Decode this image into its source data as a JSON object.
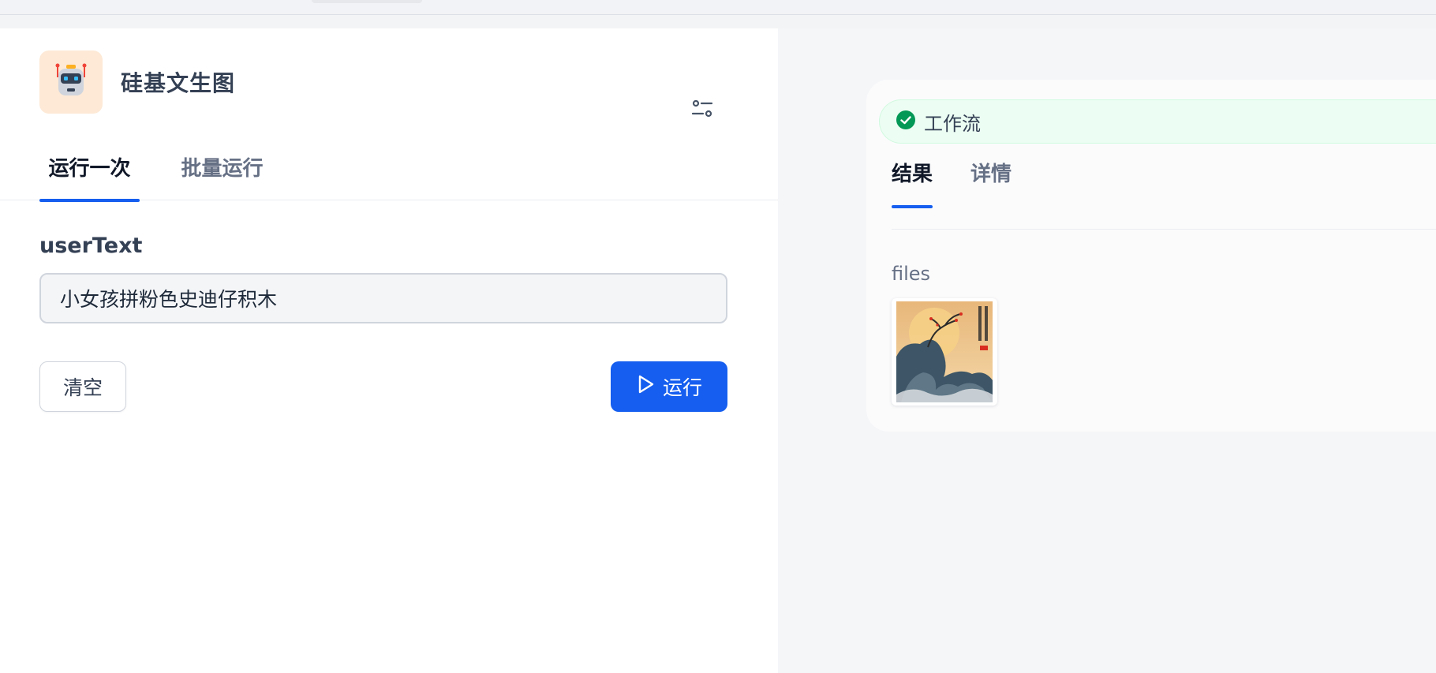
{
  "app": {
    "title": "硅基文生图",
    "icon": "robot-icon",
    "icon_bg": "#fde9d6"
  },
  "tabs": [
    {
      "label": "运行一次",
      "active": true
    },
    {
      "label": "批量运行",
      "active": false
    }
  ],
  "form": {
    "field_label": "userText",
    "input_value": "小女孩拼粉色史迪仔积木",
    "clear_label": "清空",
    "run_label": "运行"
  },
  "result": {
    "status_label": "工作流",
    "status_color": "#039855",
    "tabs": [
      {
        "label": "结果",
        "active": true
      },
      {
        "label": "详情",
        "active": false
      }
    ],
    "files_label": "files"
  },
  "colors": {
    "accent": "#155eef",
    "success": "#039855"
  },
  "icons": {
    "settings": "sliders-icon",
    "run": "play-icon",
    "status": "check-circle-icon"
  }
}
